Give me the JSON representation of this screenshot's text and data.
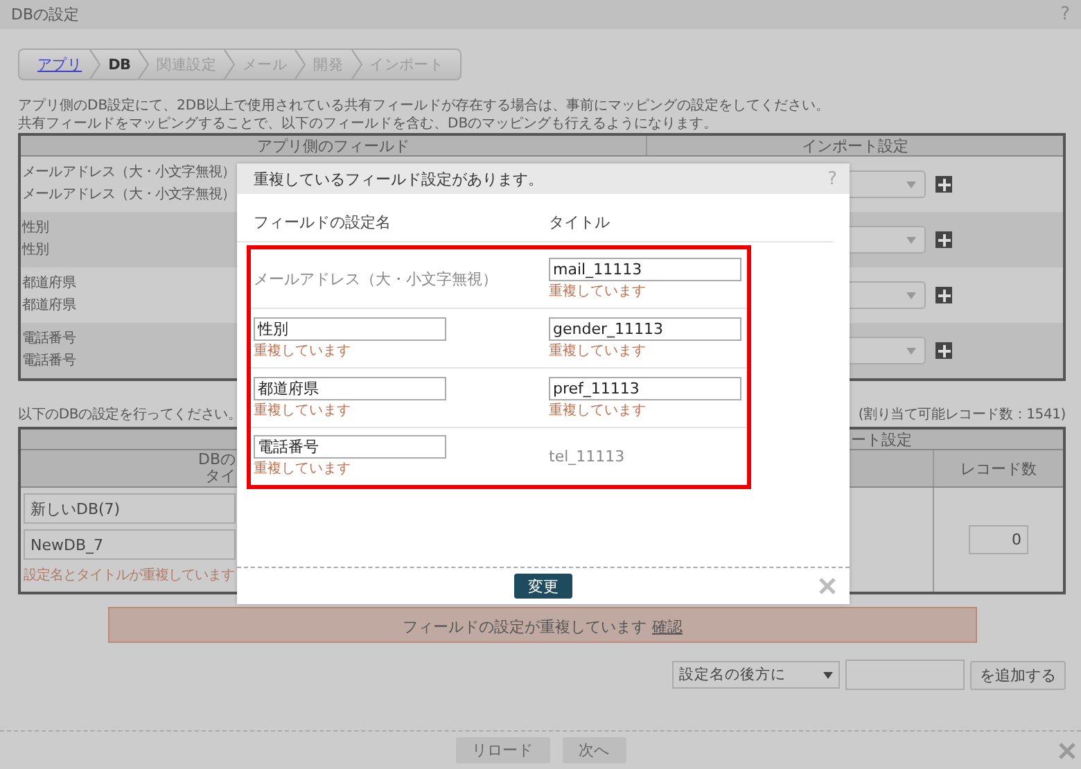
{
  "window": {
    "title": "DBの設定",
    "help": "?"
  },
  "breadcrumb": [
    {
      "label": "アプリ",
      "kind": "link"
    },
    {
      "label": "DB",
      "kind": "current"
    },
    {
      "label": "関連設定",
      "kind": "disabled"
    },
    {
      "label": "メール",
      "kind": "disabled"
    },
    {
      "label": "開発",
      "kind": "disabled"
    },
    {
      "label": "インポート",
      "kind": "disabled"
    }
  ],
  "description": [
    "アプリ側のDB設定にて、2DB以上で使用されている共有フィールドが存在する場合は、事前にマッピングの設定をしてください。",
    "共有フィールドをマッピングすることで、以下のフィールドを含む、DBのマッピングも行えるようになります。"
  ],
  "mapping_table": {
    "columns": [
      "アプリ側のフィールド",
      "インポート設定"
    ],
    "rows": [
      {
        "lines": [
          "メールアドレス（大・小文字無視）",
          "メールアドレス（大・小文字無視）"
        ]
      },
      {
        "lines": [
          "性別",
          "性別"
        ]
      },
      {
        "lines": [
          "都道府県",
          "都道府県"
        ]
      },
      {
        "lines": [
          "電話番号",
          "電話番号"
        ]
      }
    ]
  },
  "db_section": {
    "instruction": "以下のDBの設定を行ってください。",
    "available": "(割り当て可能レコード数：1541)",
    "header_group": "ート設定",
    "header_lines": [
      "DBの",
      "タイ"
    ],
    "record_header": "レコード数",
    "name_value": "新しいDB(7)",
    "title_value": "NewDB_7",
    "error": "設定名とタイトルが重複しています",
    "record_value": "0"
  },
  "error_bar": {
    "text": "フィールドの設定が重複しています",
    "link": "確認"
  },
  "add_row": {
    "position": "設定名の後方に",
    "button": "を追加する"
  },
  "footer": {
    "buttons": [
      "リロード",
      "次へ"
    ]
  },
  "dialog": {
    "title": "重複しているフィールド設定があります。",
    "help": "?",
    "columns": [
      "フィールドの設定名",
      "タイトル"
    ],
    "rows": [
      {
        "name": {
          "kind": "text",
          "value": "メールアドレス（大・小文字無視）"
        },
        "title": {
          "kind": "input",
          "value": "mail_11113",
          "error": "重複しています"
        }
      },
      {
        "name": {
          "kind": "input",
          "value": "性別",
          "error": "重複しています"
        },
        "title": {
          "kind": "input",
          "value": "gender_11113",
          "error": "重複しています"
        }
      },
      {
        "name": {
          "kind": "input",
          "value": "都道府県",
          "error": "重複しています"
        },
        "title": {
          "kind": "input",
          "value": "pref_11113",
          "error": "重複しています"
        }
      },
      {
        "name": {
          "kind": "input",
          "value": "電話番号",
          "error": "重複しています"
        },
        "title": {
          "kind": "text",
          "value": "tel_11113"
        }
      }
    ],
    "button": "変更"
  }
}
